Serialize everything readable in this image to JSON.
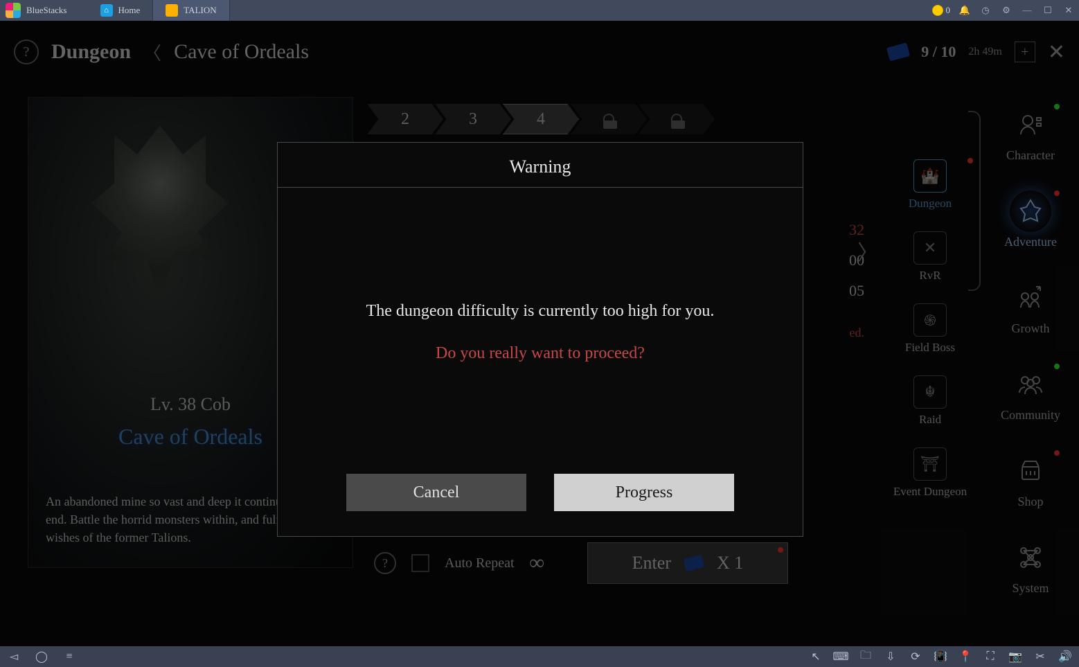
{
  "emulator": {
    "name": "BlueStacks",
    "tabs": [
      {
        "label": "Home",
        "icon": "house"
      },
      {
        "label": "TALION",
        "icon": "game",
        "active": true
      }
    ],
    "coin_balance": "0"
  },
  "header": {
    "breadcrumb_main": "Dungeon",
    "breadcrumb_sub": "Cave of Ordeals",
    "ticket_count": "9 / 10",
    "ticket_timer": "2h 49m"
  },
  "dungeon_card": {
    "level_label": "Lv. 38 Cob",
    "title": "Cave of Ordeals",
    "description": "An abandoned mine so vast and deep it continues without end. Battle the horrid monsters within, and fulfill the last wishes of the former Talions."
  },
  "stages": [
    "2",
    "3",
    "4",
    "lock",
    "lock"
  ],
  "stage_selected_index": 2,
  "behind_values": {
    "v1": "32",
    "v2": "00",
    "v3": "05",
    "v4": "ed."
  },
  "categories": [
    {
      "label": "Dungeon",
      "icon": "castle",
      "active": true,
      "dot": "red"
    },
    {
      "label": "RvR",
      "icon": "swords"
    },
    {
      "label": "Field Boss",
      "icon": "tornado"
    },
    {
      "label": "Raid",
      "icon": "dragon"
    },
    {
      "label": "Event Dungeon",
      "icon": "gate"
    }
  ],
  "main_menu": [
    {
      "label": "Character",
      "dot": "green"
    },
    {
      "label": "Adventure",
      "active": true,
      "dot": "red"
    },
    {
      "label": "Growth"
    },
    {
      "label": "Community",
      "dot": "green"
    },
    {
      "label": "Shop",
      "dot": "red"
    },
    {
      "label": "System"
    }
  ],
  "bottom": {
    "auto_repeat_label": "Auto Repeat",
    "enter_label": "Enter",
    "enter_cost": "X 1"
  },
  "modal": {
    "title": "Warning",
    "line1": "The dungeon difficulty is currently too high for you.",
    "line2": "Do you really want to proceed?",
    "cancel": "Cancel",
    "confirm": "Progress"
  }
}
